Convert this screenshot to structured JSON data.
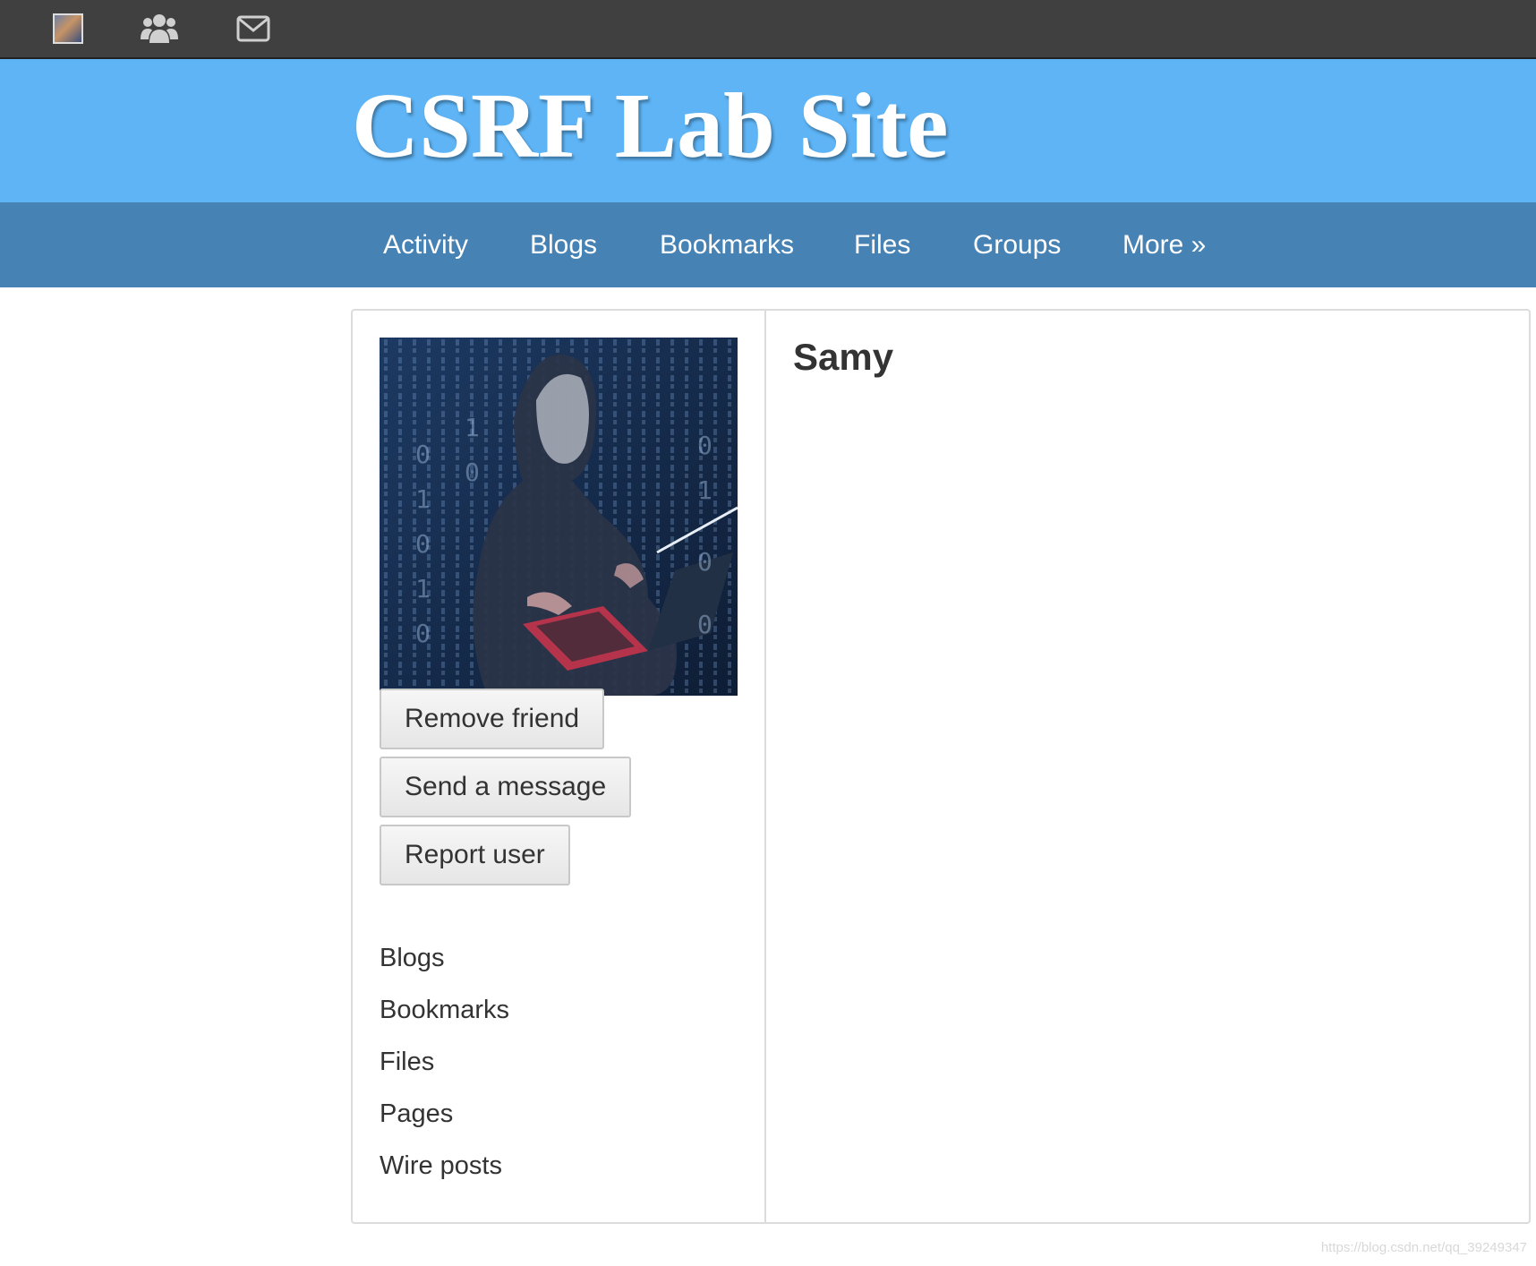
{
  "topbar": {
    "icons": [
      "user-avatar",
      "friends-icon",
      "messages-icon"
    ]
  },
  "header": {
    "site_title": "CSRF Lab Site"
  },
  "nav": {
    "items": [
      "Activity",
      "Blogs",
      "Bookmarks",
      "Files",
      "Groups",
      "More »"
    ]
  },
  "profile": {
    "name": "Samy",
    "buttons": {
      "remove_friend": "Remove friend",
      "send_message": "Send a message",
      "report_user": "Report user"
    },
    "links": [
      "Blogs",
      "Bookmarks",
      "Files",
      "Pages",
      "Wire posts"
    ]
  },
  "watermark": "https://blog.csdn.net/qq_39249347",
  "colors": {
    "topbar": "#404040",
    "header": "#5eb4f5",
    "nav": "#4682b4"
  }
}
